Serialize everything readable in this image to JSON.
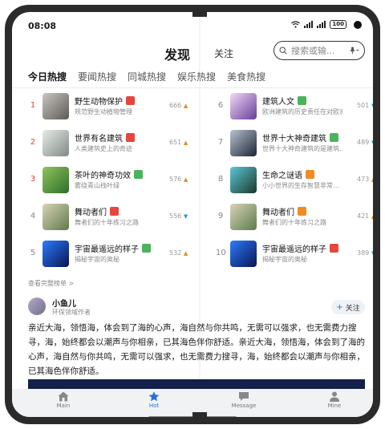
{
  "status": {
    "time": "08:08",
    "battery": "100"
  },
  "header": {
    "title": "发现",
    "follow_tab": "关注",
    "search_placeholder": "搜索或输..."
  },
  "tabs": [
    {
      "label": "今日热搜",
      "active": true
    },
    {
      "label": "要闻热搜",
      "active": false
    },
    {
      "label": "同城热搜",
      "active": false
    },
    {
      "label": "娱乐热搜",
      "active": false
    },
    {
      "label": "美食热搜",
      "active": false
    }
  ],
  "hot_list": [
    {
      "rank": "1",
      "title": "野生动物保护",
      "subtitle": "规范野生动植物管理",
      "heat": "666",
      "trend": "up",
      "badge_color": "#e5473d",
      "thumb": "linear-gradient(135deg,#c9c5c0,#5d5a55)"
    },
    {
      "rank": "2",
      "title": "世界有名建筑",
      "subtitle": "人类建筑史上的奇迹",
      "heat": "651",
      "trend": "up",
      "badge_color": "#e5473d",
      "thumb": "linear-gradient(135deg,#e8ebe8,#7d8a83)"
    },
    {
      "rank": "3",
      "title": "茶叶的神奇功效",
      "subtitle": "雾绕青山栈叶绿",
      "heat": "576",
      "trend": "up",
      "badge_color": "#4bb35a",
      "thumb": "linear-gradient(135deg,#8ec45a,#2f6e2c)"
    },
    {
      "rank": "4",
      "title": "舞动者们",
      "subtitle": "舞者们的十年练习之路",
      "heat": "556",
      "trend": "down",
      "badge_color": "#e5473d",
      "thumb": "linear-gradient(135deg,#d9d2b8,#5d7b4a)"
    },
    {
      "rank": "5",
      "title": "宇宙最遥远的样子",
      "subtitle": "揭秘宇宙的奥秘",
      "heat": "532",
      "trend": "up",
      "badge_color": "#4bb35a",
      "thumb": "linear-gradient(135deg,#2a7cff,#0a1450)"
    },
    {
      "rank": "6",
      "title": "建筑人文",
      "subtitle": "欧洲建筑的历史责任在对欧洲…",
      "heat": "501",
      "trend": "down",
      "badge_color": "#4bb35a",
      "thumb": "linear-gradient(135deg,#f0d9f3,#6a3c9c)"
    },
    {
      "rank": "7",
      "title": "世界十大神奇建筑",
      "subtitle": "世界十大神奇建筑的是建筑…",
      "heat": "489",
      "trend": "down",
      "badge_color": "#4bb35a",
      "thumb": "linear-gradient(135deg,#b7c2d0,#1d2636)"
    },
    {
      "rank": "8",
      "title": "生命之谜语",
      "subtitle": "小小世界的生存智慧非常…",
      "heat": "473",
      "trend": "up",
      "badge_color": "#f08a24",
      "thumb": "linear-gradient(135deg,#5bc6d8,#1a3a2a)"
    },
    {
      "rank": "9",
      "title": "舞动者们",
      "subtitle": "舞者们的十年练习之路",
      "heat": "421",
      "trend": "up",
      "badge_color": "#f08a24",
      "thumb": "linear-gradient(135deg,#d9d2b8,#5d7b4a)"
    },
    {
      "rank": "10",
      "title": "宇宙最遥远的样子",
      "subtitle": "揭秘宇宙的奥秘",
      "heat": "389",
      "trend": "down",
      "badge_color": "#e5473d",
      "thumb": "linear-gradient(135deg,#2a7cff,#0a1450)"
    }
  ],
  "more_link": "查看完整榜单",
  "post": {
    "author": "小鱼儿",
    "author_subtitle": "环保领域作者",
    "follow_label": "关注",
    "text": "亲近大海，领悟海，体会到了海的心声，海自然与你共鸣，无需可以强求，也无需费力搜寻，海，始终都会以潮声与你相亲，已其海色伴你舒适。亲近大海，领悟海，体会到了海的心声，海自然与你共鸣，无需可以强求，也无需费力搜寻，海，始终都会以潮声与你相亲，已其海色伴你舒适。"
  },
  "nav": [
    {
      "label": "Main",
      "icon": "home-icon",
      "active": false
    },
    {
      "label": "Hot",
      "icon": "star-icon",
      "active": true
    },
    {
      "label": "Message",
      "icon": "chat-icon",
      "active": false
    },
    {
      "label": "Mine",
      "icon": "person-icon",
      "active": false
    }
  ],
  "colors": {
    "accent": "#2a6fd6",
    "rank_top": "#d64541",
    "trend_up": "#e08a1e",
    "trend_down": "#2aa0c8"
  }
}
